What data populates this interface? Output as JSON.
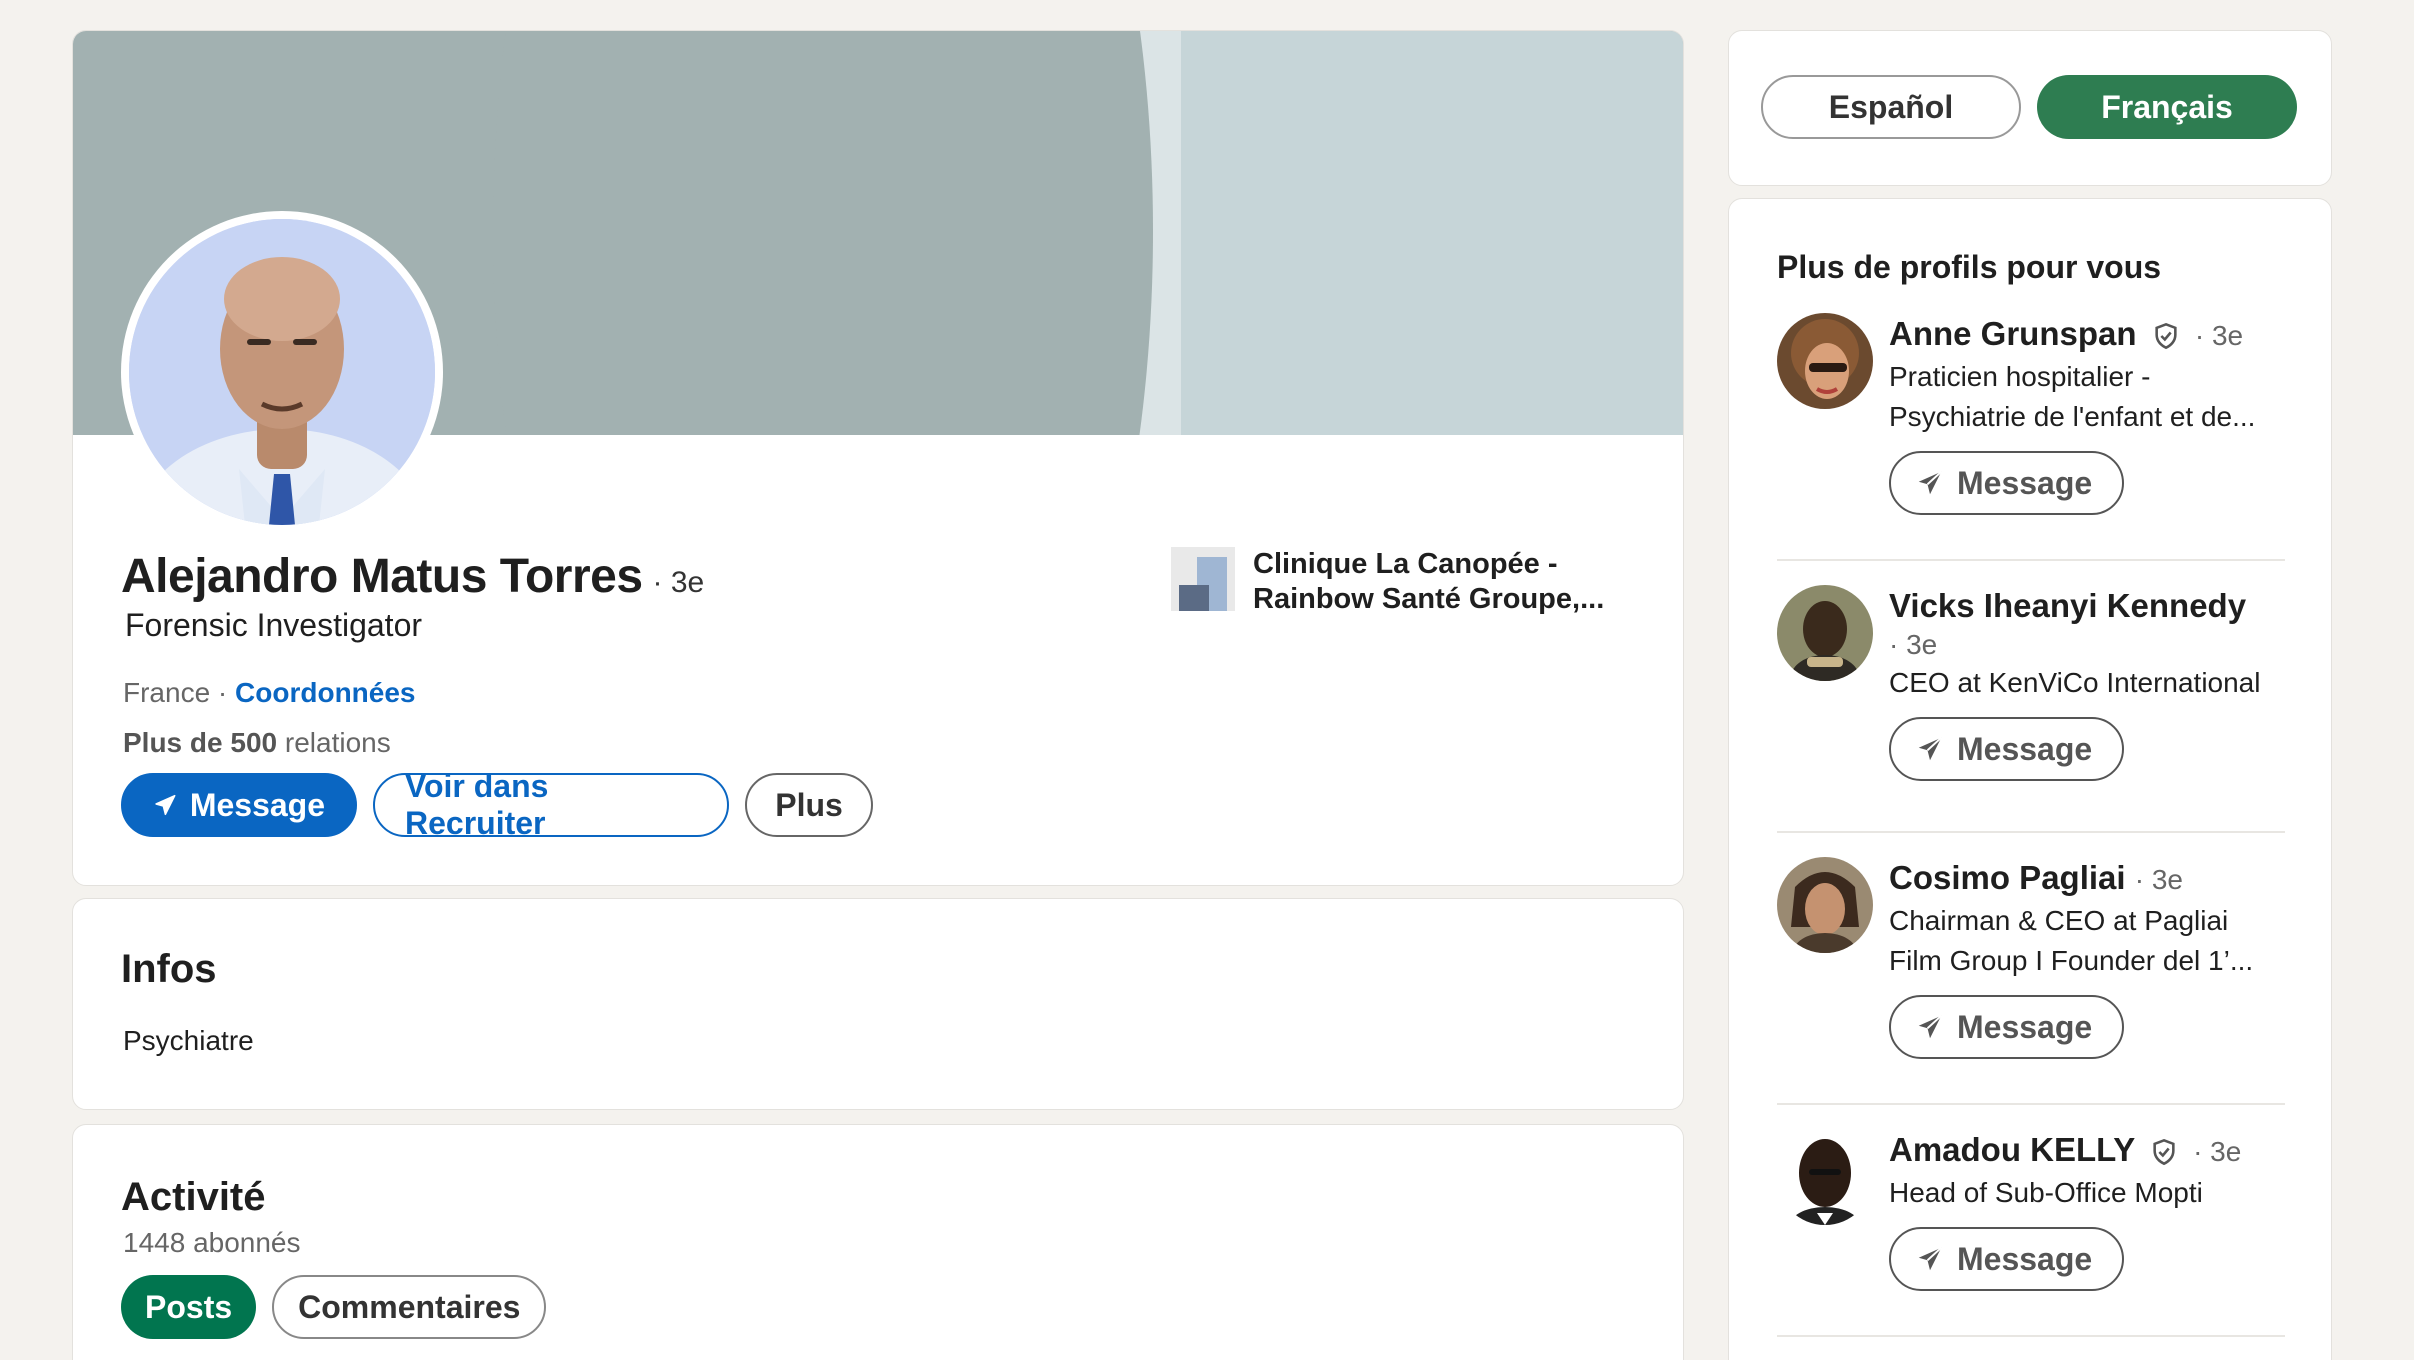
{
  "profile": {
    "name": "Alejandro Matus Torres",
    "degree": "· 3e",
    "headline": "Forensic Investigator",
    "location": "France ·",
    "contact_link": "Coordonnées",
    "relations_bold": "Plus de 500",
    "relations_suffix": "relations",
    "actions": {
      "message": "Message",
      "recruiter": "Voir dans Recruiter",
      "more": "Plus"
    },
    "company": {
      "line1": "Clinique La Canopée -",
      "line2": "Rainbow Santé Groupe,..."
    }
  },
  "infos": {
    "title": "Infos",
    "text": "Psychiatre"
  },
  "activity": {
    "title": "Activité",
    "followers": "1448 abonnés",
    "filters": [
      "Posts",
      "Commentaires"
    ]
  },
  "languages": {
    "inactive": "Español",
    "active": "Français"
  },
  "suggestions": {
    "title": "Plus de profils pour vous",
    "message_label": "Message",
    "people": [
      {
        "name": "Anne Grunspan",
        "verified": true,
        "degree": "· 3e",
        "headline_1": "Praticien hospitalier -",
        "headline_2": "Psychiatrie de l'enfant et de..."
      },
      {
        "name": "Vicks Iheanyi Kennedy",
        "verified": false,
        "degree": "· 3e",
        "headline_1": "CEO at KenViCo International",
        "headline_2": ""
      },
      {
        "name": "Cosimo Pagliai",
        "verified": false,
        "degree": "· 3e",
        "headline_1": "Chairman & CEO at Pagliai",
        "headline_2": "Film Group I Founder del 1’..."
      },
      {
        "name": "Amadou KELLY",
        "verified": true,
        "degree": "· 3e",
        "headline_1": "Head of Sub-Office Mopti",
        "headline_2": ""
      }
    ]
  },
  "colors": {
    "primary_blue": "#0a66c2",
    "green": "#01754f",
    "background": "#f4f2ee"
  },
  "icons": [
    "send-icon",
    "verified-shield-icon"
  ]
}
